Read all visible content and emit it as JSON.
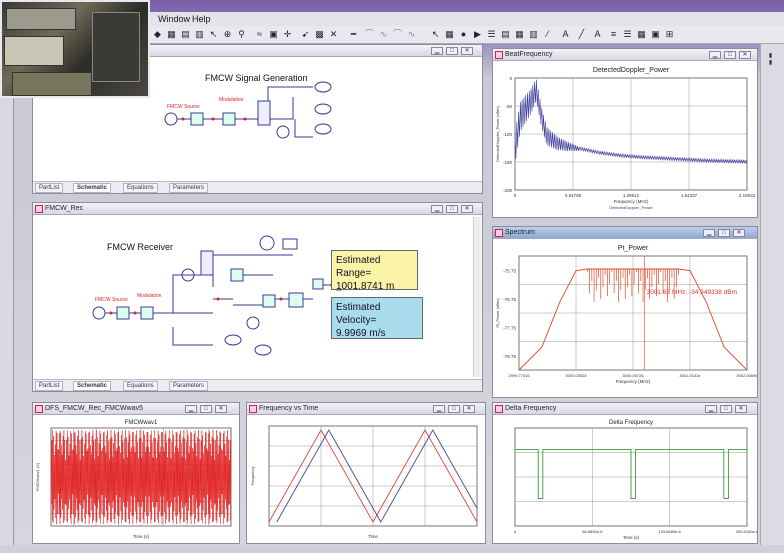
{
  "menu": {
    "window": "Window",
    "help": "Help"
  },
  "icons": {
    "toolbar": [
      "save-icon",
      "grid-icon",
      "chart-icon",
      "pointer-icon",
      "zoom-icon",
      "wire-icon",
      "plus-icon",
      "cross-icon",
      "arrow-icon",
      "play-icon",
      "list-icon",
      "line-icon",
      "font-icon"
    ]
  },
  "signal_gen": {
    "window_title": "",
    "diagram_title": "FMCW Signal Generation",
    "label_source": "FMCW Source",
    "label_mod": "Modulation",
    "tabs": [
      "PartList",
      "Schematic",
      "Equations",
      "Parameters"
    ]
  },
  "receiver": {
    "window_title": "FMCW_Rec",
    "diagram_title": "FMCW Receiver",
    "label_source": "FMCW Source",
    "label_mod": "Modulation",
    "range_label": "Estimated Range=",
    "range_value": "1001.8741 m",
    "velocity_label": "Estimated Velocity=",
    "velocity_value": "9.9969 m/s",
    "tabs": [
      "PartList",
      "Schematic",
      "Equations",
      "Parameters"
    ]
  },
  "beat": {
    "window_title": "BeatFrequency",
    "chart_data": {
      "type": "line",
      "title": "DetectedDoppler_Power",
      "xlabel": "Frequency (MHz)",
      "ylabel": "DetectedDoppler_Power (dBm)",
      "legend": "DetectedDoppler_Power",
      "y_ticks": [
        "0",
        "-50",
        "-100",
        "-150",
        "-200"
      ],
      "x_ticks": [
        "0",
        "0.54795",
        "1.09512",
        "1.64337",
        "2.19033"
      ],
      "series": [
        {
          "x": [
            0.0,
            0.05,
            0.1,
            0.15,
            0.2,
            0.25,
            0.3,
            0.4,
            0.5,
            0.6,
            0.8,
            1.0,
            1.2,
            1.4,
            1.6,
            1.8,
            2.0,
            2.19
          ],
          "y": [
            -110,
            -55,
            -42,
            -30,
            -10,
            -60,
            -95,
            -110,
            -118,
            -124,
            -132,
            -137,
            -140,
            -142,
            -144,
            -146,
            -147,
            -148
          ]
        }
      ],
      "ylim": [
        -200,
        0
      ],
      "xlim": [
        0,
        2.19033
      ]
    }
  },
  "spectrum": {
    "window_title": "Spectrum",
    "chart_data": {
      "type": "line",
      "title": "Pt_Power",
      "xlabel": "Frequency (MHz)",
      "ylabel": "Pt_Power (dBm)",
      "y_ticks": [
        "-75.75",
        "-76.75",
        "-77.75",
        "-78.75"
      ],
      "x_ticks": [
        "2999.77316",
        "3000.03528",
        "3000.05726",
        "3001.0131e",
        "3002.00696"
      ],
      "annotation": "3001.83 MHz, -34.949338 dBm",
      "series": [
        {
          "x": [
            0,
            0.1,
            0.18,
            0.25,
            0.3,
            0.5,
            0.7,
            0.75,
            0.82,
            0.9,
            1.0
          ],
          "y": [
            -79,
            -78.3,
            -76.9,
            -75.95,
            -75.9,
            -75.9,
            -75.9,
            -75.95,
            -76.9,
            -78.3,
            -79
          ]
        }
      ],
      "ylim": [
        -79,
        -75.5
      ]
    }
  },
  "dfs": {
    "window_title": "DFS_FMCW_Rec_FMCWwav5",
    "chart_data": {
      "type": "line",
      "title": "FMCWwav1",
      "xlabel": "Time (s)",
      "ylabel": "FMCWwav1 (V)"
    }
  },
  "fvt": {
    "window_title": "Frequency vs Time",
    "chart_data": {
      "type": "line",
      "xlabel": "Time",
      "ylabel": "Frequency",
      "series": [
        {
          "x": [
            0,
            1,
            2,
            3,
            4
          ],
          "y": [
            0,
            1,
            0,
            1,
            0
          ],
          "color": "#d44"
        },
        {
          "x": [
            0.15,
            1.15,
            2.15,
            3.15,
            4.0
          ],
          "y": [
            0,
            1,
            0,
            1,
            0.15
          ],
          "color": "#449"
        }
      ]
    }
  },
  "delta": {
    "window_title": "Delta Frequency",
    "chart_data": {
      "type": "line",
      "title": "Delta Frequency",
      "xlabel": "Time (s)",
      "x_ticks": [
        "0",
        "66.8890e-6",
        "133.6680e-6",
        "200.6440e-6"
      ],
      "series": [
        {
          "x": [
            0,
            0.1,
            0.1,
            0.12,
            0.12,
            0.5,
            0.5,
            0.52,
            0.52,
            0.9,
            0.9,
            0.92,
            0.92,
            1.0
          ],
          "y": [
            1,
            1,
            0,
            0,
            1,
            1,
            0,
            0,
            1,
            1,
            0,
            0,
            1,
            1
          ]
        }
      ]
    }
  },
  "colors": {
    "signal": "#3a3a9a",
    "spectrum": "#e04a2a",
    "wave": "#e01818",
    "delta": "#3a9a3a",
    "range_box": "#fbf3a8",
    "velocity_box": "#a9dcec"
  }
}
